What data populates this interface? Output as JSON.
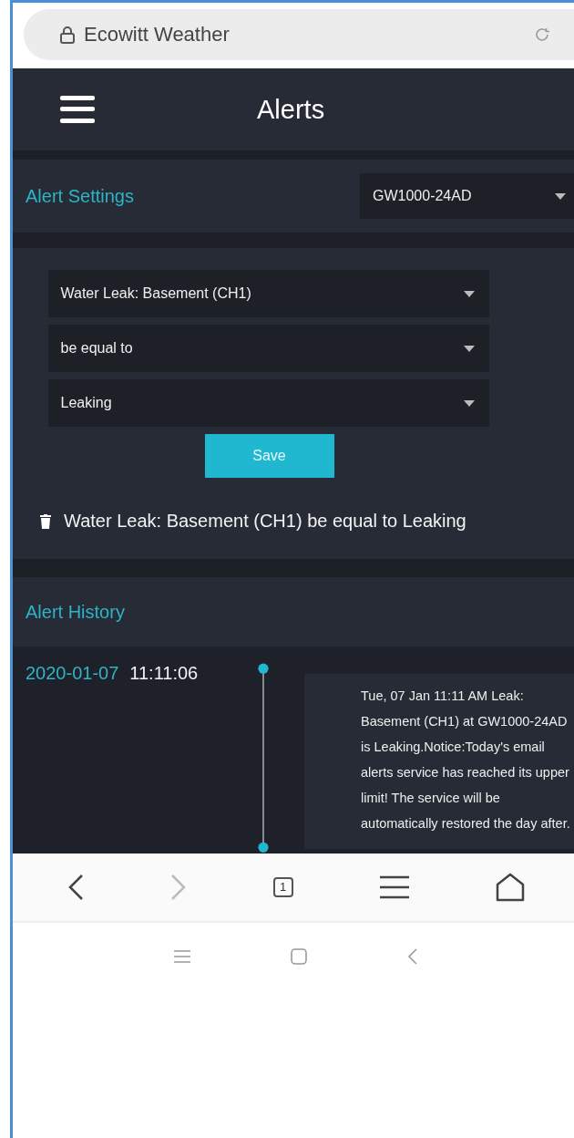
{
  "browser": {
    "title": "Ecowitt Weather"
  },
  "header": {
    "title": "Alerts"
  },
  "settings": {
    "title": "Alert Settings",
    "device": "GW1000-24AD"
  },
  "form": {
    "selects": [
      "Water Leak: Basement (CH1)",
      "be equal to",
      "Leaking"
    ],
    "save": "Save"
  },
  "rules": [
    "Water Leak: Basement (CH1) be equal to Leaking"
  ],
  "history": {
    "title": "Alert History",
    "entries": [
      {
        "date": "2020-01-07",
        "time": "11:11:06",
        "message": "Tue, 07 Jan 11:11 AM Leak: Basement (CH1) at GW1000-24AD is Leaking.Notice:Today's email alerts service has reached its upper limit! The service will be automatically restored the day after."
      }
    ]
  },
  "toolbar": {
    "tab_count": "1"
  }
}
